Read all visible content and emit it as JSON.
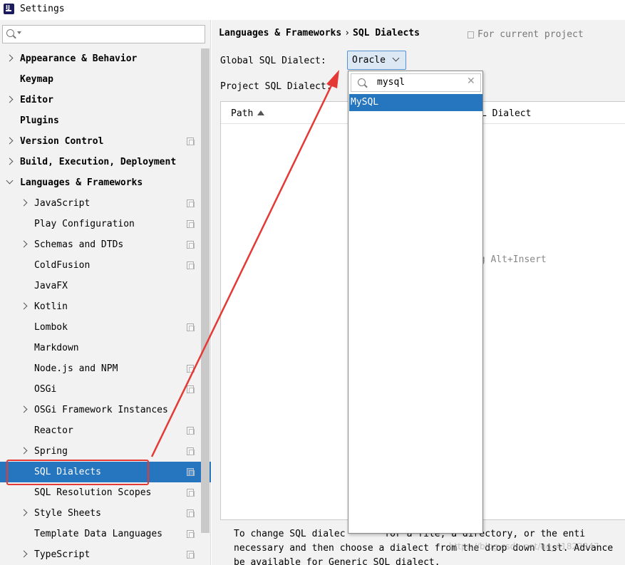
{
  "window": {
    "title": "Settings",
    "icon": "intellij-app-icon"
  },
  "sidebar": {
    "search_value": "",
    "items": [
      {
        "label": "Appearance & Behavior",
        "level": 0,
        "expandable": true,
        "expanded": false,
        "project_icon": false
      },
      {
        "label": "Keymap",
        "level": 0,
        "expandable": false,
        "project_icon": false
      },
      {
        "label": "Editor",
        "level": 0,
        "expandable": true,
        "expanded": false,
        "project_icon": false
      },
      {
        "label": "Plugins",
        "level": 0,
        "expandable": false,
        "project_icon": false
      },
      {
        "label": "Version Control",
        "level": 0,
        "expandable": true,
        "expanded": false,
        "project_icon": true
      },
      {
        "label": "Build, Execution, Deployment",
        "level": 0,
        "expandable": true,
        "expanded": false,
        "project_icon": false
      },
      {
        "label": "Languages & Frameworks",
        "level": 0,
        "expandable": true,
        "expanded": true,
        "project_icon": false
      },
      {
        "label": "JavaScript",
        "level": 1,
        "expandable": true,
        "expanded": false,
        "project_icon": true
      },
      {
        "label": "Play Configuration",
        "level": 1,
        "expandable": false,
        "project_icon": true
      },
      {
        "label": "Schemas and DTDs",
        "level": 1,
        "expandable": true,
        "expanded": false,
        "project_icon": true
      },
      {
        "label": "ColdFusion",
        "level": 1,
        "expandable": false,
        "project_icon": true
      },
      {
        "label": "JavaFX",
        "level": 1,
        "expandable": false,
        "project_icon": false
      },
      {
        "label": "Kotlin",
        "level": 1,
        "expandable": true,
        "expanded": false,
        "project_icon": false
      },
      {
        "label": "Lombok",
        "level": 1,
        "expandable": false,
        "project_icon": true
      },
      {
        "label": "Markdown",
        "level": 1,
        "expandable": false,
        "project_icon": false
      },
      {
        "label": "Node.js and NPM",
        "level": 1,
        "expandable": false,
        "project_icon": true
      },
      {
        "label": "OSGi",
        "level": 1,
        "expandable": false,
        "project_icon": true
      },
      {
        "label": "OSGi Framework Instances",
        "level": 1,
        "expandable": true,
        "expanded": false,
        "project_icon": false
      },
      {
        "label": "Reactor",
        "level": 1,
        "expandable": false,
        "project_icon": true
      },
      {
        "label": "Spring",
        "level": 1,
        "expandable": true,
        "expanded": false,
        "project_icon": true
      },
      {
        "label": "SQL Dialects",
        "level": 1,
        "expandable": false,
        "project_icon": true,
        "selected": true
      },
      {
        "label": "SQL Resolution Scopes",
        "level": 1,
        "expandable": false,
        "project_icon": true
      },
      {
        "label": "Style Sheets",
        "level": 1,
        "expandable": true,
        "expanded": false,
        "project_icon": true
      },
      {
        "label": "Template Data Languages",
        "level": 1,
        "expandable": false,
        "project_icon": true
      },
      {
        "label": "TypeScript",
        "level": 1,
        "expandable": true,
        "expanded": false,
        "project_icon": true
      }
    ]
  },
  "main": {
    "breadcrumb_parent": "Languages & Frameworks",
    "breadcrumb_sep": "›",
    "breadcrumb_current": "SQL Dialects",
    "scope_label": "For current project",
    "global_label": "Global SQL Dialect:",
    "global_value": "Oracle",
    "project_label": "Project SQL Dialect:",
    "table": {
      "col_path": "Path",
      "col_dialect": "L Dialect",
      "empty_hint": "ng Alt+Insert"
    },
    "description_lines": [
      "To change SQL dialec       for a file, a directory, or the enti",
      "necessary and then choose a dialect from the drop down list. Advance",
      "be available for Generic SQL dialect."
    ]
  },
  "dropdown_popup": {
    "search_value": "mysql",
    "items": [
      "MySQL"
    ]
  },
  "annotation": {
    "color": "#e53935"
  },
  "watermark": "https://blog.csdn.net/qq_41823347"
}
